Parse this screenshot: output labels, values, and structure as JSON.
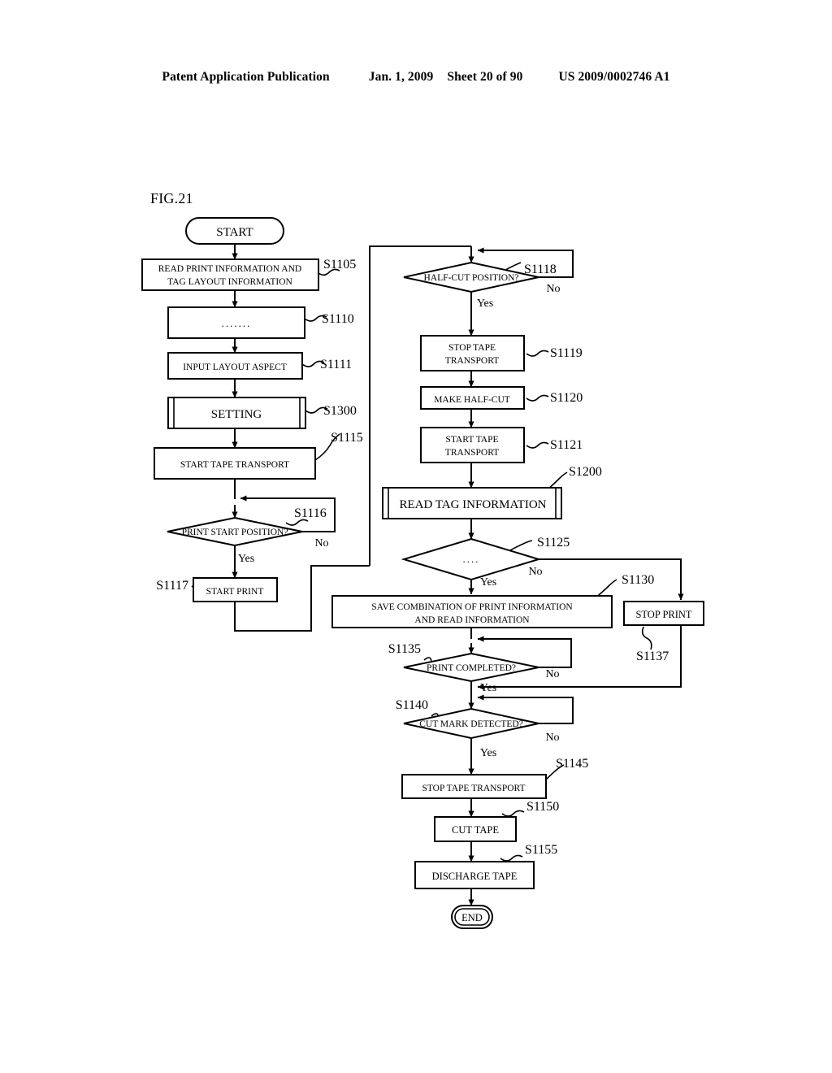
{
  "header": {
    "publication": "Patent Application Publication",
    "date": "Jan. 1, 2009",
    "sheet": "Sheet 20 of 90",
    "patent_number": "US 2009/0002746 A1"
  },
  "figure": {
    "label": "FIG.21"
  },
  "flowchart": {
    "terminals": {
      "start": "START",
      "end": "END"
    },
    "nodes": [
      {
        "id": "S1105",
        "step": "S1105",
        "type": "process",
        "lines": [
          "READ PRINT INFORMATION AND",
          "TAG LAYOUT INFORMATION"
        ]
      },
      {
        "id": "S1110",
        "step": "S1110",
        "type": "process",
        "lines": [
          "......."
        ]
      },
      {
        "id": "S1111",
        "step": "S1111",
        "type": "process",
        "lines": [
          "INPUT LAYOUT ASPECT"
        ]
      },
      {
        "id": "S1300",
        "step": "S1300",
        "type": "predefined",
        "lines": [
          "SETTING"
        ]
      },
      {
        "id": "S1115",
        "step": "S1115",
        "type": "process",
        "lines": [
          "START TAPE TRANSPORT"
        ]
      },
      {
        "id": "S1116",
        "step": "S1116",
        "type": "decision",
        "lines": [
          "PRINT START POSITION?"
        ]
      },
      {
        "id": "S1117",
        "step": "S1117",
        "type": "process",
        "lines": [
          "START PRINT"
        ]
      },
      {
        "id": "S1118",
        "step": "S1118",
        "type": "decision",
        "lines": [
          "HALF-CUT POSITION?"
        ]
      },
      {
        "id": "S1119",
        "step": "S1119",
        "type": "process",
        "lines": [
          "STOP TAPE",
          "TRANSPORT"
        ]
      },
      {
        "id": "S1120",
        "step": "S1120",
        "type": "process",
        "lines": [
          "MAKE HALF-CUT"
        ]
      },
      {
        "id": "S1121",
        "step": "S1121",
        "type": "process",
        "lines": [
          "START TAPE",
          "TRANSPORT"
        ]
      },
      {
        "id": "S1200",
        "step": "S1200",
        "type": "predefined",
        "lines": [
          "READ TAG INFORMATION"
        ]
      },
      {
        "id": "S1125",
        "step": "S1125",
        "type": "decision",
        "lines": [
          "...."
        ]
      },
      {
        "id": "S1130",
        "step": "S1130",
        "type": "process",
        "lines": [
          "SAVE COMBINATION OF PRINT INFORMATION",
          "AND READ INFORMATION"
        ]
      },
      {
        "id": "S1137",
        "step": "S1137",
        "type": "process",
        "lines": [
          "STOP PRINT"
        ]
      },
      {
        "id": "S1135",
        "step": "S1135",
        "type": "decision",
        "lines": [
          "PRINT COMPLETED?"
        ]
      },
      {
        "id": "S1140",
        "step": "S1140",
        "type": "decision",
        "lines": [
          "CUT MARK DETECTED?"
        ]
      },
      {
        "id": "S1145",
        "step": "S1145",
        "type": "process",
        "lines": [
          "STOP TAPE TRANSPORT"
        ]
      },
      {
        "id": "S1150",
        "step": "S1150",
        "type": "process",
        "lines": [
          "CUT TAPE"
        ]
      },
      {
        "id": "S1155",
        "step": "S1155",
        "type": "process",
        "lines": [
          "DISCHARGE TAPE"
        ]
      }
    ],
    "branch_labels": {
      "s1116_yes": "Yes",
      "s1116_no": "No",
      "s1118_yes": "Yes",
      "s1118_no": "No",
      "s1125_yes": "Yes",
      "s1125_no": "No",
      "s1135_yes": "Yes",
      "s1135_no": "No",
      "s1140_yes": "Yes",
      "s1140_no": "No"
    }
  },
  "colors": {
    "ink": "#000000",
    "paper": "#ffffff"
  }
}
